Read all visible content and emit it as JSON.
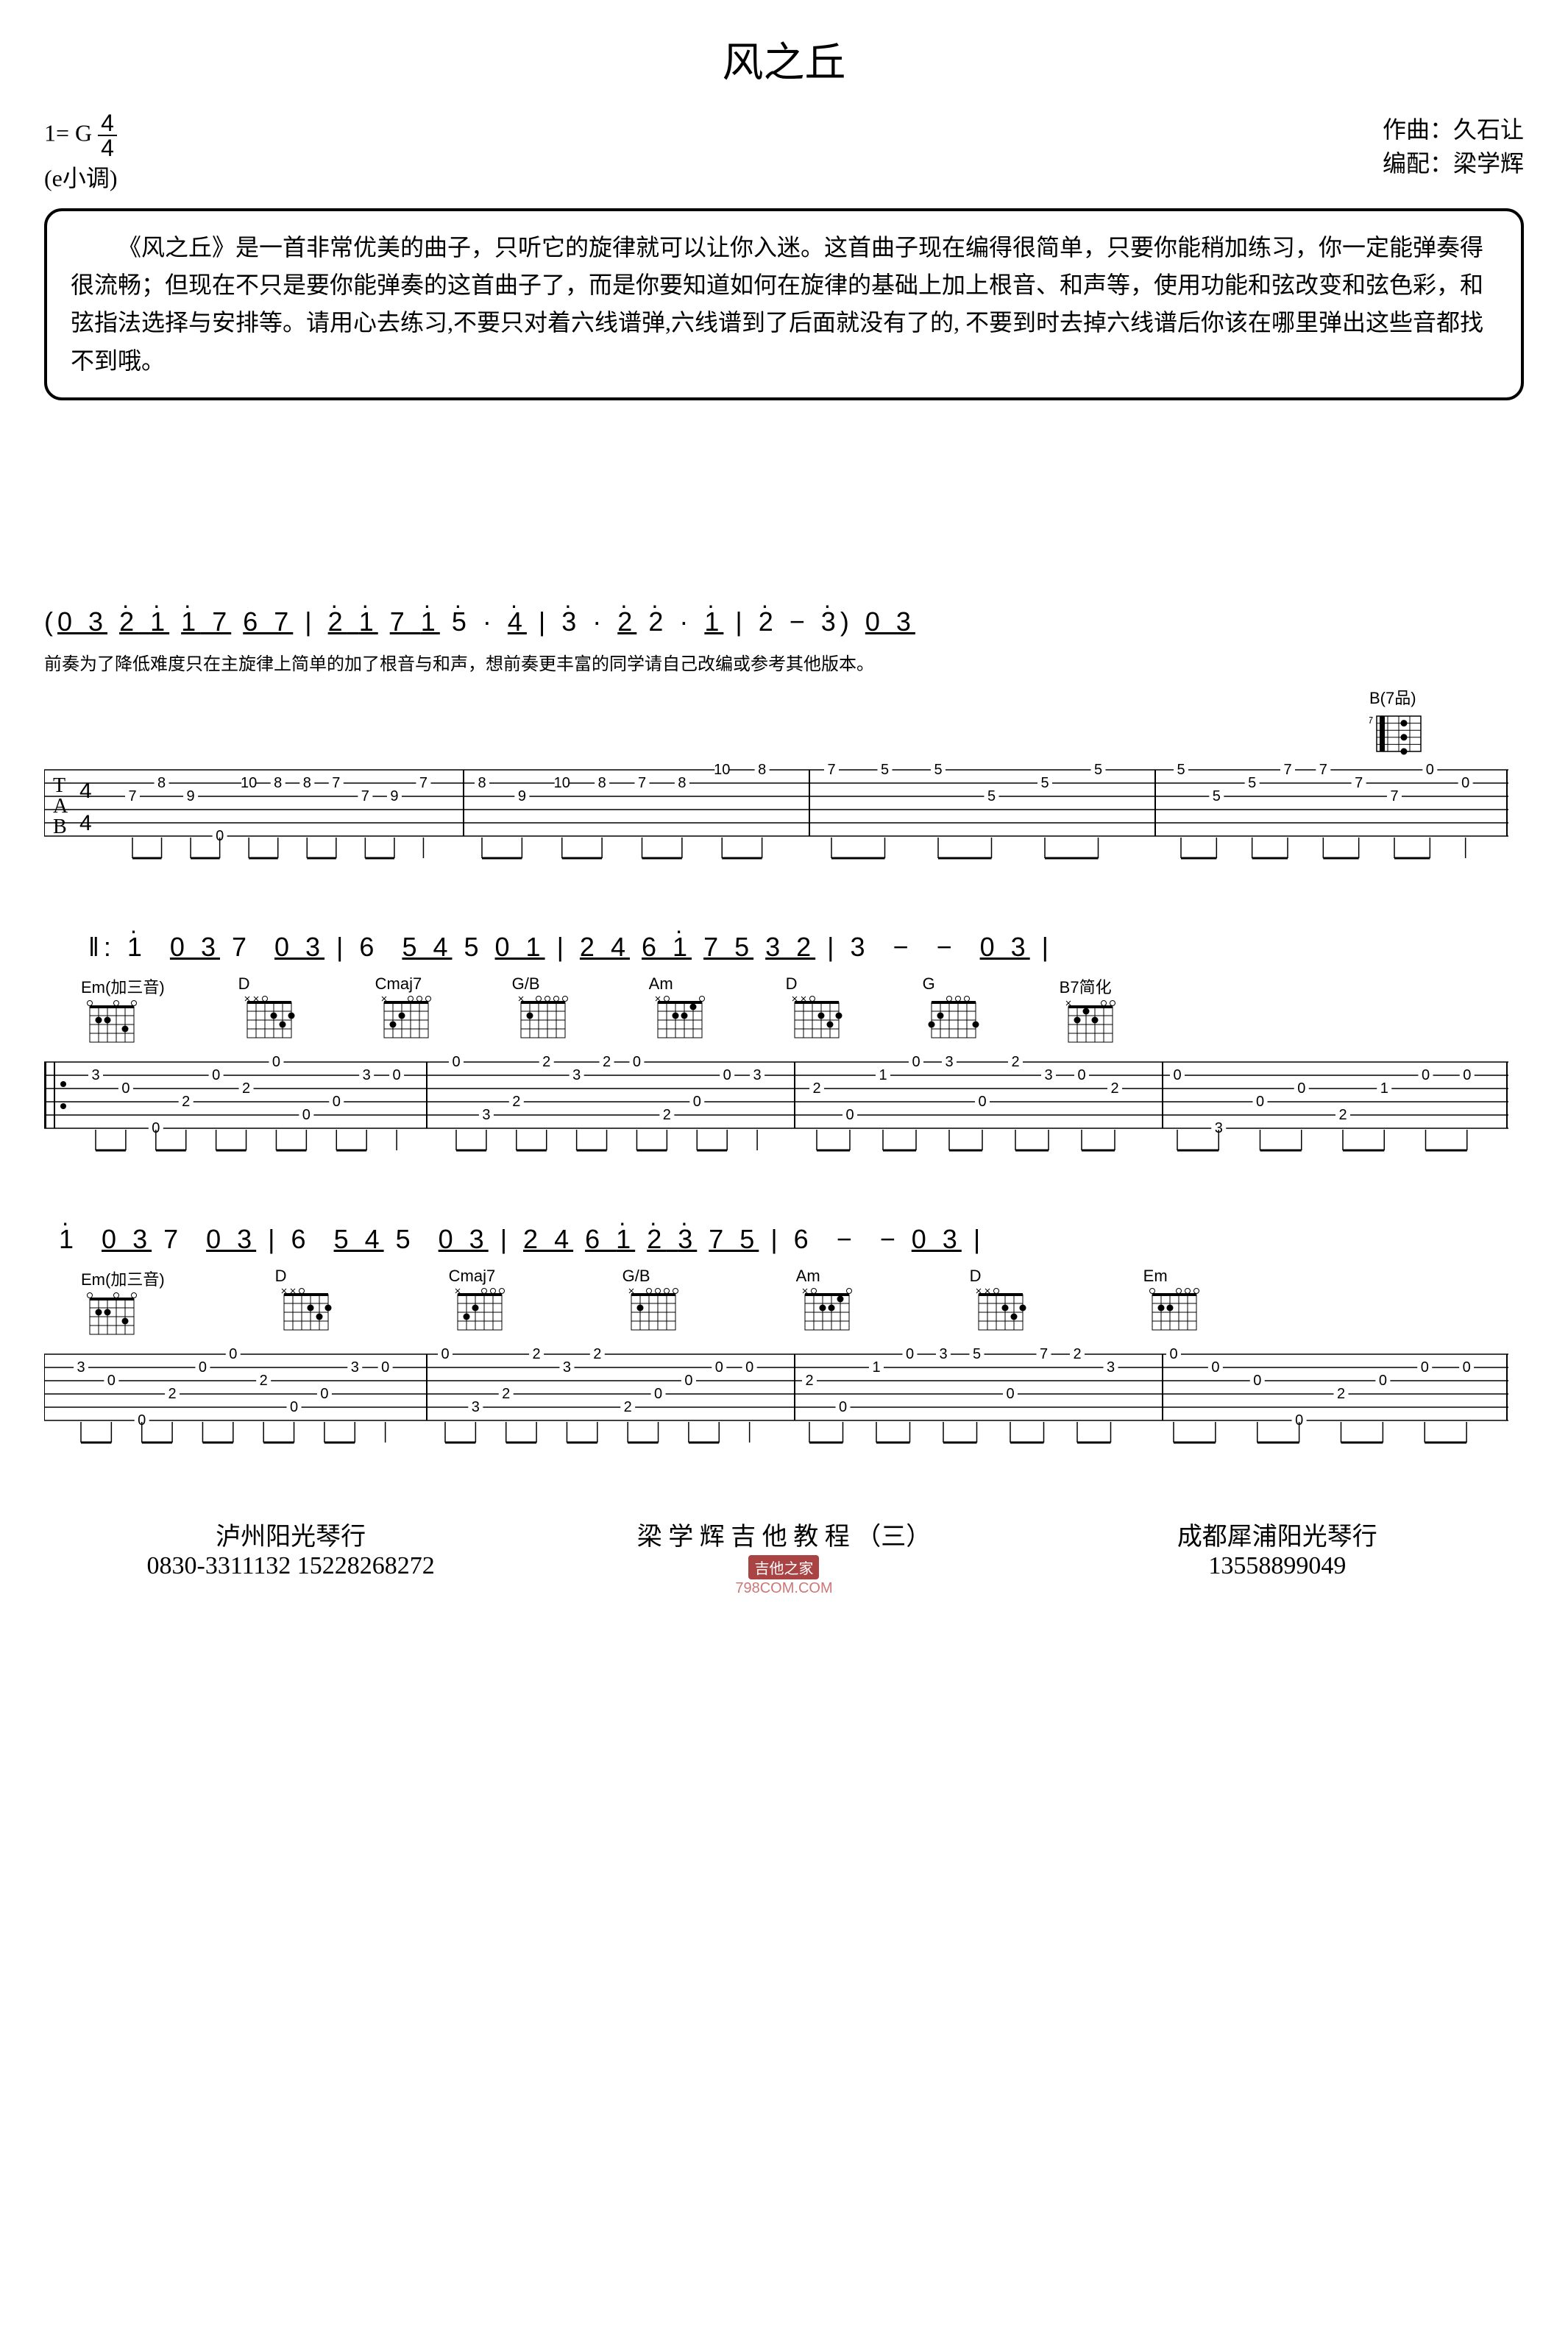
{
  "title": "风之丘",
  "header": {
    "key_sig": "1= G",
    "time_sig_top": "4",
    "time_sig_bottom": "4",
    "mode": "(e小调)",
    "composer_label": "作曲：",
    "composer": "久石让",
    "arranger_label": "编配：",
    "arranger": "梁学辉"
  },
  "intro_text": "《风之丘》是一首非常优美的曲子，只听它的旋律就可以让你入迷。这首曲子现在编得很简单，只要你能稍加练习，你一定能弹奏得很流畅；但现在不只是要你能弹奏的这首曲子了，而是你要知道如何在旋律的基础上加上根音、和声等，使用功能和弦改变和弦色彩，和弦指法选择与安排等。请用心去练习,不要只对着六线谱弹,六线谱到了后面就没有了的, 不要到时去掉六线谱后你该在哪里弹出这些音都找不到哦。",
  "jianpu": {
    "line1": "(0 3 2 1 1 7 6 7 | 2 1 7 1 5 · 4 | 3 · 2 2 · 1 | 2 − 3) 0 3",
    "line2": "1  0 3 7  0 3 | 6  5 4 5 0 1 | 2 4 6 1 7 5 3 2 | 3  −  −  0 3 |",
    "line3": "1  0 3 7  0 3 | 6  5 4 5  0 3 | 2 4 6 1 2 3 7 5 | 6  −  − 0 3 |"
  },
  "caption_line1": "前奏为了降低难度只在主旋律上简单的加了根音与和声，想前奏更丰富的同学请自己改编或参考其他版本。",
  "chord_labels": {
    "b7": "B(7品)",
    "em_add3": "Em(加三音)",
    "d": "D",
    "cmaj7": "Cmaj7",
    "gb": "G/B",
    "am": "Am",
    "g": "G",
    "b7_simple": "B7简化",
    "em": "Em"
  },
  "tab_data": {
    "system1": {
      "time_sig": "4/4",
      "measures": [
        {
          "notes": [
            {
              "s": 3,
              "f": "7"
            },
            {
              "s": 2,
              "f": "8"
            },
            {
              "s": 3,
              "f": "9"
            },
            {
              "s": 6,
              "f": "0"
            },
            {
              "s": 2,
              "f": "10"
            },
            {
              "s": 2,
              "f": "8"
            },
            {
              "s": 2,
              "f": "8"
            },
            {
              "s": 2,
              "f": "7"
            },
            {
              "s": 3,
              "f": "7"
            },
            {
              "s": 3,
              "f": "9"
            },
            {
              "s": 2,
              "f": "7"
            }
          ]
        },
        {
          "notes": [
            {
              "s": 2,
              "f": "8"
            },
            {
              "s": 3,
              "f": "9"
            },
            {
              "s": 2,
              "f": "10"
            },
            {
              "s": 2,
              "f": "8"
            },
            {
              "s": 2,
              "f": "7"
            },
            {
              "s": 2,
              "f": "8"
            },
            {
              "s": 1,
              "f": "10"
            },
            {
              "s": 1,
              "f": "8"
            }
          ]
        },
        {
          "notes": [
            {
              "s": 1,
              "f": "7"
            },
            {
              "s": 1,
              "f": "5"
            },
            {
              "s": 1,
              "f": "5"
            },
            {
              "s": 3,
              "f": "5"
            },
            {
              "s": 2,
              "f": "5"
            },
            {
              "s": 1,
              "f": "5"
            }
          ]
        },
        {
          "notes": [
            {
              "s": 1,
              "f": "5"
            },
            {
              "s": 3,
              "f": "5"
            },
            {
              "s": 2,
              "f": "5"
            },
            {
              "s": 1,
              "f": "7"
            },
            {
              "s": 1,
              "f": "7"
            },
            {
              "s": 2,
              "f": "7"
            },
            {
              "s": 3,
              "f": "7"
            },
            {
              "s": 1,
              "f": "0"
            },
            {
              "s": 2,
              "f": "0"
            }
          ]
        }
      ]
    },
    "system2": {
      "measures": [
        {
          "chords": [
            "Em(加三音)",
            "D"
          ],
          "notes": [
            {
              "s": 2,
              "f": "3"
            },
            {
              "s": 3,
              "f": "0"
            },
            {
              "s": 6,
              "f": "0"
            },
            {
              "s": 4,
              "f": "2"
            },
            {
              "s": 2,
              "f": "0"
            },
            {
              "s": 3,
              "f": "2"
            },
            {
              "s": 1,
              "f": "0"
            },
            {
              "s": 5,
              "f": "0"
            },
            {
              "s": 4,
              "f": "0"
            },
            {
              "s": 2,
              "f": "3"
            },
            {
              "s": 2,
              "f": "0"
            }
          ]
        },
        {
          "chords": [
            "Cmaj7",
            "G/B"
          ],
          "notes": [
            {
              "s": 1,
              "f": "0"
            },
            {
              "s": 5,
              "f": "3"
            },
            {
              "s": 4,
              "f": "2"
            },
            {
              "s": 1,
              "f": "2"
            },
            {
              "s": 2,
              "f": "3"
            },
            {
              "s": 1,
              "f": "2"
            },
            {
              "s": 1,
              "f": "0"
            },
            {
              "s": 5,
              "f": "2"
            },
            {
              "s": 4,
              "f": "0"
            },
            {
              "s": 2,
              "f": "0"
            },
            {
              "s": 2,
              "f": "3"
            }
          ]
        },
        {
          "chords": [
            "Am",
            "D"
          ],
          "notes": [
            {
              "s": 3,
              "f": "2"
            },
            {
              "s": 5,
              "f": "0"
            },
            {
              "s": 2,
              "f": "1"
            },
            {
              "s": 1,
              "f": "0"
            },
            {
              "s": 1,
              "f": "3"
            },
            {
              "s": 4,
              "f": "0"
            },
            {
              "s": 1,
              "f": "2"
            },
            {
              "s": 2,
              "f": "3"
            },
            {
              "s": 2,
              "f": "0"
            },
            {
              "s": 3,
              "f": "2"
            }
          ]
        },
        {
          "chords": [
            "G",
            "B7简化"
          ],
          "notes": [
            {
              "s": 2,
              "f": "0"
            },
            {
              "s": 6,
              "f": "3"
            },
            {
              "s": 4,
              "f": "0"
            },
            {
              "s": 3,
              "f": "0"
            },
            {
              "s": 5,
              "f": "2"
            },
            {
              "s": 3,
              "f": "1"
            },
            {
              "s": 2,
              "f": "0"
            },
            {
              "s": 2,
              "f": "0"
            }
          ]
        }
      ]
    },
    "system3": {
      "measures": [
        {
          "chords": [
            "Em(加三音)",
            "D"
          ],
          "notes": [
            {
              "s": 2,
              "f": "3"
            },
            {
              "s": 3,
              "f": "0"
            },
            {
              "s": 6,
              "f": "0"
            },
            {
              "s": 4,
              "f": "2"
            },
            {
              "s": 2,
              "f": "0"
            },
            {
              "s": 1,
              "f": "0"
            },
            {
              "s": 3,
              "f": "2"
            },
            {
              "s": 5,
              "f": "0"
            },
            {
              "s": 4,
              "f": "0"
            },
            {
              "s": 2,
              "f": "3"
            },
            {
              "s": 2,
              "f": "0"
            }
          ]
        },
        {
          "chords": [
            "Cmaj7",
            "G/B"
          ],
          "notes": [
            {
              "s": 1,
              "f": "0"
            },
            {
              "s": 5,
              "f": "3"
            },
            {
              "s": 4,
              "f": "2"
            },
            {
              "s": 1,
              "f": "2"
            },
            {
              "s": 2,
              "f": "3"
            },
            {
              "s": 1,
              "f": "2"
            },
            {
              "s": 5,
              "f": "2"
            },
            {
              "s": 4,
              "f": "0"
            },
            {
              "s": 3,
              "f": "0"
            },
            {
              "s": 2,
              "f": "0"
            },
            {
              "s": 2,
              "f": "0"
            }
          ]
        },
        {
          "chords": [
            "Am",
            "D"
          ],
          "notes": [
            {
              "s": 3,
              "f": "2"
            },
            {
              "s": 5,
              "f": "0"
            },
            {
              "s": 2,
              "f": "1"
            },
            {
              "s": 1,
              "f": "0"
            },
            {
              "s": 1,
              "f": "3"
            },
            {
              "s": 1,
              "f": "5"
            },
            {
              "s": 4,
              "f": "0"
            },
            {
              "s": 1,
              "f": "7"
            },
            {
              "s": 1,
              "f": "2"
            },
            {
              "s": 2,
              "f": "3"
            }
          ]
        },
        {
          "chords": [
            "Em"
          ],
          "notes": [
            {
              "s": 1,
              "f": "0"
            },
            {
              "s": 2,
              "f": "0"
            },
            {
              "s": 3,
              "f": "0"
            },
            {
              "s": 6,
              "f": "0"
            },
            {
              "s": 4,
              "f": "2"
            },
            {
              "s": 3,
              "f": "0"
            },
            {
              "s": 2,
              "f": "0"
            },
            {
              "s": 2,
              "f": "0"
            }
          ]
        }
      ]
    }
  },
  "footer": {
    "left_name": "泸州阳光琴行",
    "left_phones": "0830-3311132  15228268272",
    "center_name": "梁 学 辉 吉 他 教 程 （三）",
    "center_watermark": "吉他之家",
    "center_watermark2": "798COM.COM",
    "right_name": "成都犀浦阳光琴行",
    "right_phone": "13558899049"
  }
}
